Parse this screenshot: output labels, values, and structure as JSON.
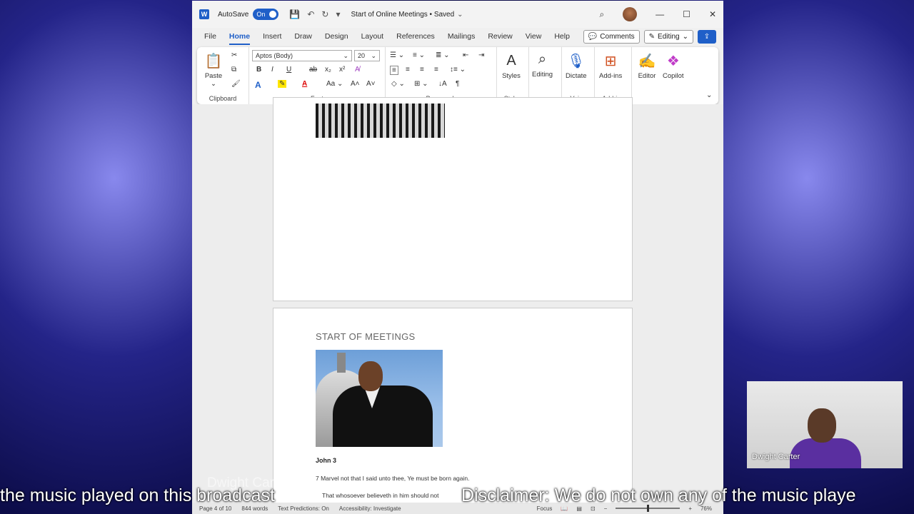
{
  "titlebar": {
    "autosave_label": "AutoSave",
    "autosave_state": "On",
    "doc_title": "Start of Online Meetings • Saved"
  },
  "menu": {
    "tabs": [
      "File",
      "Home",
      "Insert",
      "Draw",
      "Design",
      "Layout",
      "References",
      "Mailings",
      "Review",
      "View",
      "Help"
    ],
    "active_tab": "Home",
    "comments_label": "Comments",
    "editing_label": "Editing"
  },
  "ribbon": {
    "clipboard": {
      "paste_label": "Paste",
      "group_label": "Clipboard"
    },
    "font": {
      "font_name": "Aptos (Body)",
      "font_size": "20",
      "group_label": "Font",
      "case_label": "Aa"
    },
    "paragraph": {
      "group_label": "Paragraph"
    },
    "styles": {
      "styles_label": "Styles",
      "group_label": "Styles"
    },
    "editing": {
      "label": "Editing"
    },
    "voice": {
      "dictate_label": "Dictate",
      "group_label": "Voice"
    },
    "addins": {
      "label": "Add-ins",
      "group_label": "Add-ins"
    },
    "editor_label": "Editor",
    "copilot_label": "Copilot"
  },
  "document": {
    "heading": "START OF MEETINGS",
    "para_title": "John 3",
    "line1": "7 Marvel not that I said unto thee, Ye must be born again.",
    "line2": "That whosoever believeth in him should not"
  },
  "status": {
    "page": "Page 4 of 10",
    "words": "844 words",
    "predictions": "Text Predictions: On",
    "accessibility": "Accessibility: Investigate",
    "focus": "Focus",
    "zoom": "76%"
  },
  "overlay": {
    "presenter_name": "Dwight Carter",
    "ticker_left": "the music played on this broadcast",
    "ticker_right": "Disclaimer: We do not own any of the music playe"
  },
  "colors": {
    "accent": "#1f5fc8",
    "background": "#0c0c48"
  }
}
